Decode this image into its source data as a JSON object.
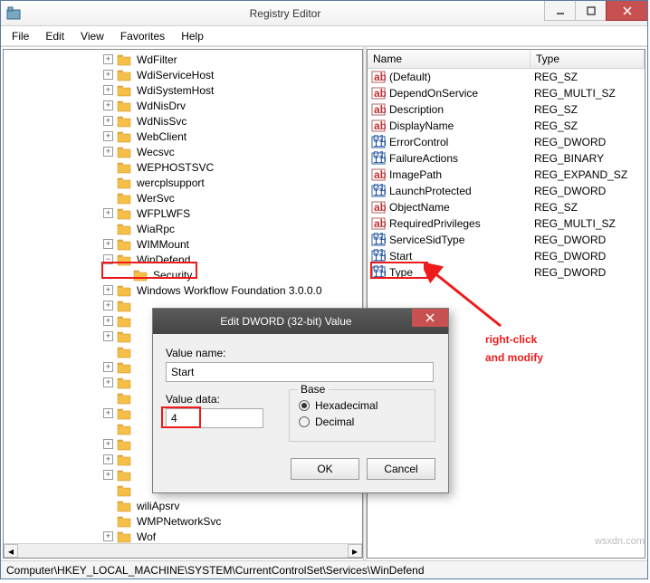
{
  "window": {
    "title": "Registry Editor"
  },
  "menus": [
    "File",
    "Edit",
    "View",
    "Favorites",
    "Help"
  ],
  "tree": [
    {
      "label": "WdFilter",
      "exp": "+",
      "indent": 0
    },
    {
      "label": "WdiServiceHost",
      "exp": "+",
      "indent": 0
    },
    {
      "label": "WdiSystemHost",
      "exp": "+",
      "indent": 0
    },
    {
      "label": "WdNisDrv",
      "exp": "+",
      "indent": 0
    },
    {
      "label": "WdNisSvc",
      "exp": "+",
      "indent": 0
    },
    {
      "label": "WebClient",
      "exp": "+",
      "indent": 0
    },
    {
      "label": "Wecsvc",
      "exp": "+",
      "indent": 0
    },
    {
      "label": "WEPHOSTSVC",
      "exp": "",
      "indent": 0
    },
    {
      "label": "wercplsupport",
      "exp": "",
      "indent": 0
    },
    {
      "label": "WerSvc",
      "exp": "",
      "indent": 0
    },
    {
      "label": "WFPLWFS",
      "exp": "+",
      "indent": 0
    },
    {
      "label": "WiaRpc",
      "exp": "",
      "indent": 0
    },
    {
      "label": "WIMMount",
      "exp": "+",
      "indent": 0
    },
    {
      "label": "WinDefend",
      "exp": "−",
      "indent": 0,
      "highlight": true
    },
    {
      "label": "Security",
      "exp": "",
      "indent": 1
    },
    {
      "label": "Windows Workflow Foundation 3.0.0.0",
      "exp": "+",
      "indent": 0
    },
    {
      "label": "",
      "exp": "+",
      "indent": 0
    },
    {
      "label": "",
      "exp": "+",
      "indent": 0
    },
    {
      "label": "",
      "exp": "+",
      "indent": 0
    },
    {
      "label": "",
      "exp": "",
      "indent": 0
    },
    {
      "label": "",
      "exp": "+",
      "indent": 0
    },
    {
      "label": "",
      "exp": "+",
      "indent": 0
    },
    {
      "label": "",
      "exp": "",
      "indent": 0
    },
    {
      "label": "",
      "exp": "+",
      "indent": 0
    },
    {
      "label": "",
      "exp": "",
      "indent": 0
    },
    {
      "label": "",
      "exp": "+",
      "indent": 0
    },
    {
      "label": "",
      "exp": "+",
      "indent": 0
    },
    {
      "label": "",
      "exp": "+",
      "indent": 0
    },
    {
      "label": "",
      "exp": "",
      "indent": 0
    },
    {
      "label": "wiliApsrv",
      "exp": "",
      "indent": 0
    },
    {
      "label": "WMPNetworkSvc",
      "exp": "",
      "indent": 0
    },
    {
      "label": "Wof",
      "exp": "+",
      "indent": 0
    }
  ],
  "list": {
    "headers": {
      "name": "Name",
      "type": "Type"
    },
    "rows": [
      {
        "name": "(Default)",
        "type": "REG_SZ",
        "icon": "ab"
      },
      {
        "name": "DependOnService",
        "type": "REG_MULTI_SZ",
        "icon": "ab"
      },
      {
        "name": "Description",
        "type": "REG_SZ",
        "icon": "ab"
      },
      {
        "name": "DisplayName",
        "type": "REG_SZ",
        "icon": "ab"
      },
      {
        "name": "ErrorControl",
        "type": "REG_DWORD",
        "icon": "bin"
      },
      {
        "name": "FailureActions",
        "type": "REG_BINARY",
        "icon": "bin"
      },
      {
        "name": "ImagePath",
        "type": "REG_EXPAND_SZ",
        "icon": "ab"
      },
      {
        "name": "LaunchProtected",
        "type": "REG_DWORD",
        "icon": "bin"
      },
      {
        "name": "ObjectName",
        "type": "REG_SZ",
        "icon": "ab"
      },
      {
        "name": "RequiredPrivileges",
        "type": "REG_MULTI_SZ",
        "icon": "ab"
      },
      {
        "name": "ServiceSidType",
        "type": "REG_DWORD",
        "icon": "bin"
      },
      {
        "name": "Start",
        "type": "REG_DWORD",
        "icon": "bin",
        "highlight": true
      },
      {
        "name": "Type",
        "type": "REG_DWORD",
        "icon": "bin"
      }
    ]
  },
  "statusbar": "Computer\\HKEY_LOCAL_MACHINE\\SYSTEM\\CurrentControlSet\\Services\\WinDefend",
  "dialog": {
    "title": "Edit DWORD (32-bit) Value",
    "value_name_label": "Value name:",
    "value_name": "Start",
    "value_data_label": "Value data:",
    "value_data": "4",
    "base_label": "Base",
    "hex_label": "Hexadecimal",
    "dec_label": "Decimal",
    "ok": "OK",
    "cancel": "Cancel"
  },
  "annotation": {
    "text1": "right-click",
    "text2": "and modify"
  },
  "watermark": "wsxdn.com"
}
